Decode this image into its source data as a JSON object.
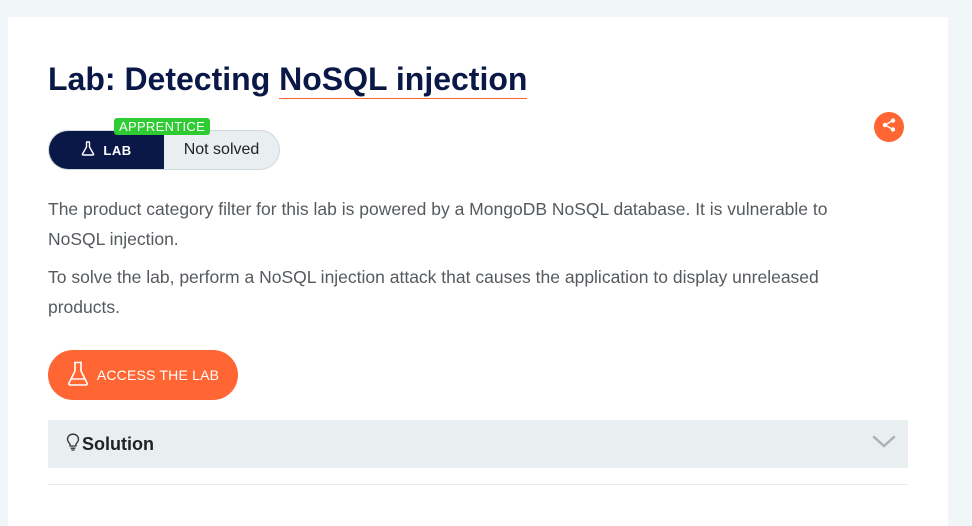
{
  "header": {
    "title_prefix": "Lab: Detecting ",
    "title_underlined": "NoSQL injection"
  },
  "badge": {
    "level": "APPRENTICE",
    "lab_label": "LAB",
    "status": "Not solved",
    "lab_icon": "flask-icon"
  },
  "share": {
    "icon": "share-icon",
    "color": "#ff6633"
  },
  "description": {
    "paragraph1": "The product category filter for this lab is powered by a MongoDB NoSQL database. It is vulnerable to NoSQL injection.",
    "paragraph2": "To solve the lab, perform a NoSQL injection attack that causes the application to display unreleased products."
  },
  "access_button": {
    "label": "ACCESS THE LAB",
    "icon": "flask-icon",
    "color": "#ff6633"
  },
  "solution": {
    "label": "Solution",
    "icon": "lightbulb-icon",
    "toggle_icon": "chevron-down-icon"
  },
  "colors": {
    "brand_navy": "#0a1847",
    "accent_orange": "#ff6633",
    "level_green": "#2ecc32"
  }
}
